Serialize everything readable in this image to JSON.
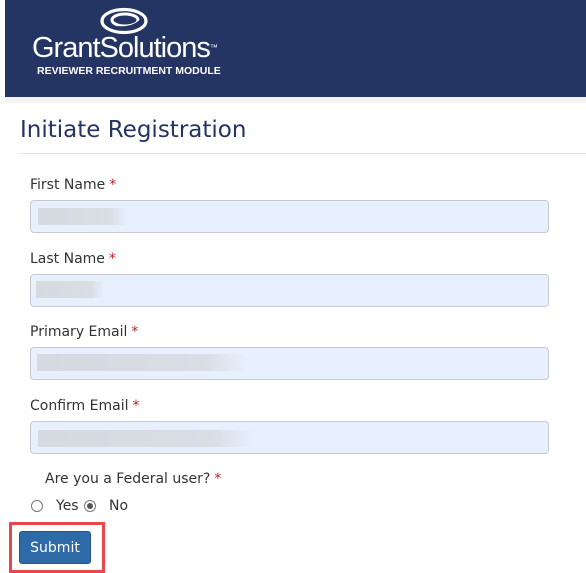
{
  "header": {
    "logo_name": "GrantSolutions",
    "logo_trademark": "™",
    "logo_subtitle": "REVIEWER RECRUITMENT MODULE",
    "logo_icon": "swirl-logo-icon",
    "background": "#243463"
  },
  "page": {
    "title": "Initiate Registration"
  },
  "form": {
    "required_marker": "*",
    "first_name": {
      "label": "First Name",
      "value": ""
    },
    "last_name": {
      "label": "Last Name",
      "value": ""
    },
    "primary_email": {
      "label": "Primary Email",
      "value": ""
    },
    "confirm_email": {
      "label": "Confirm Email",
      "value": ""
    },
    "federal_question": "Are you a Federal user?",
    "federal_options": [
      {
        "label": "Yes",
        "selected": false
      },
      {
        "label": "No",
        "selected": true
      }
    ],
    "submit_label": "Submit"
  },
  "colors": {
    "accent": "#2e6aa8",
    "required": "#b3272e",
    "highlight": "#e8474d",
    "field_background": "#e8f0fe"
  }
}
